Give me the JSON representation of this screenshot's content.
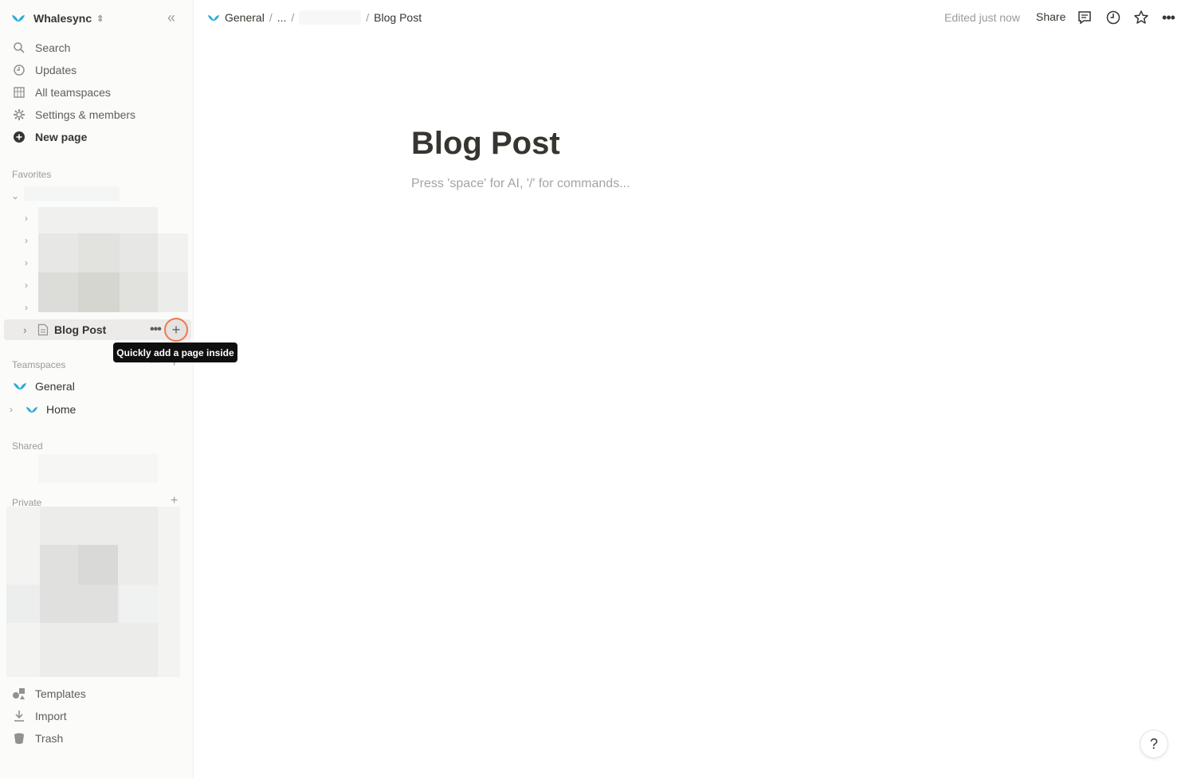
{
  "workspace": {
    "name": "Whalesync"
  },
  "sidebar": {
    "nav": [
      {
        "label": "Search",
        "icon": "search-icon"
      },
      {
        "label": "Updates",
        "icon": "clock-icon"
      },
      {
        "label": "All teamspaces",
        "icon": "building-icon"
      },
      {
        "label": "Settings & members",
        "icon": "gear-icon"
      },
      {
        "label": "New page",
        "icon": "plus-circle-icon"
      }
    ],
    "favorites_label": "Favorites",
    "current_page": {
      "label": "Blog Post"
    },
    "tooltip": "Quickly add a page inside",
    "teamspaces_label": "Teamspaces",
    "teamspaces": [
      {
        "label": "General"
      },
      {
        "label": "Home"
      }
    ],
    "shared_label": "Shared",
    "private_label": "Private",
    "bottom": [
      {
        "label": "Templates",
        "icon": "templates-icon"
      },
      {
        "label": "Import",
        "icon": "import-icon"
      },
      {
        "label": "Trash",
        "icon": "trash-icon"
      }
    ]
  },
  "topbar": {
    "crumbs": [
      "General",
      "...",
      "Blog Post"
    ],
    "edited": "Edited just now",
    "share": "Share"
  },
  "page": {
    "title": "Blog Post",
    "placeholder": "Press 'space' for AI, '/' for commands..."
  },
  "help": "?",
  "colors": {
    "accent": "#2eaadc",
    "highlight": "#f0784b"
  }
}
